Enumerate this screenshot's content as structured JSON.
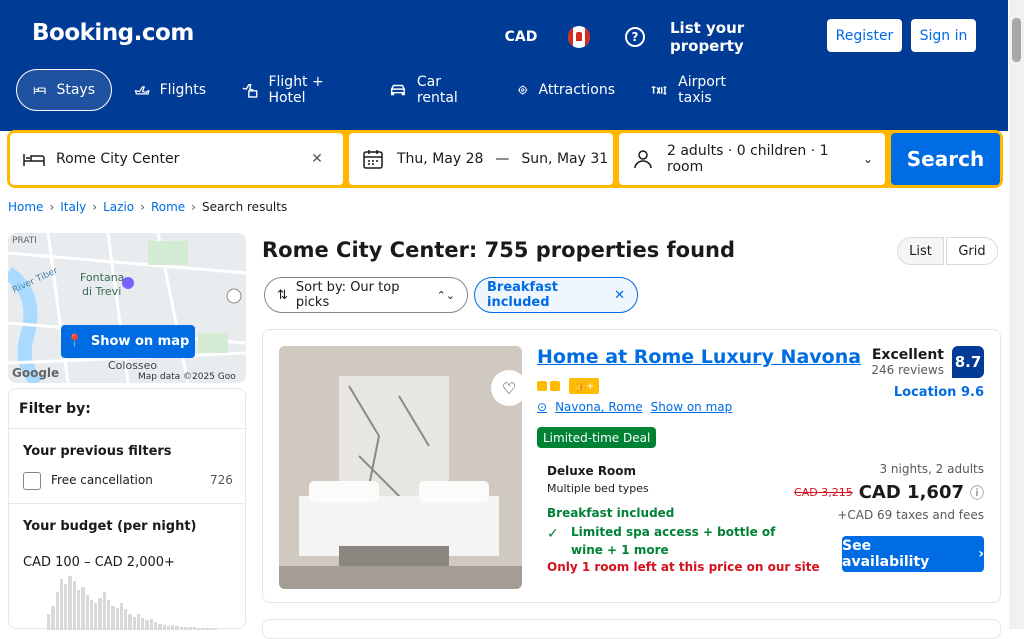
{
  "header": {
    "logo": "Booking.com",
    "currency": "CAD",
    "list_property": "List your property",
    "register": "Register",
    "sign_in": "Sign in",
    "tabs": [
      {
        "label": "Stays",
        "icon": "bed-icon"
      },
      {
        "label": "Flights",
        "icon": "plane-icon"
      },
      {
        "label": "Flight + Hotel",
        "icon": "flight-hotel-icon"
      },
      {
        "label": "Car rental",
        "icon": "car-icon"
      },
      {
        "label": "Attractions",
        "icon": "attractions-icon"
      },
      {
        "label": "Airport taxis",
        "icon": "taxi-icon"
      }
    ]
  },
  "search": {
    "destination": "Rome City Center",
    "checkin": "Thu, May 28",
    "date_sep": "—",
    "checkout": "Sun, May 31",
    "guests": "2 adults · 0 children · 1 room",
    "button": "Search"
  },
  "breadcrumb": [
    "Home",
    "Italy",
    "Lazio",
    "Rome",
    "Search results"
  ],
  "map": {
    "button": "Show on map",
    "labels": {
      "prati": "PRATI",
      "fontana1": "Fontana",
      "fontana2": "di Trevi",
      "river": "River Tiber",
      "colosseo": "Colosseo",
      "google": "Google",
      "credit": "Map data ©2025 Goo"
    }
  },
  "filters": {
    "title": "Filter by:",
    "previous": "Your previous filters",
    "free_cancel": "Free cancellation",
    "free_cancel_count": "726",
    "budget_title": "Your budget (per night)",
    "budget_range": "CAD 100 – CAD 2,000+",
    "histogram": [
      0.3,
      0.45,
      0.7,
      0.95,
      0.85,
      1.0,
      0.9,
      0.75,
      0.8,
      0.65,
      0.55,
      0.5,
      0.6,
      0.7,
      0.55,
      0.45,
      0.4,
      0.5,
      0.38,
      0.3,
      0.25,
      0.3,
      0.22,
      0.18,
      0.2,
      0.14,
      0.12,
      0.1,
      0.08,
      0.1,
      0.07,
      0.06,
      0.05,
      0.06,
      0.05,
      0.04,
      0.04,
      0.03,
      0.03,
      0.02
    ]
  },
  "results": {
    "title": "Rome City Center: 755 properties found",
    "view_list": "List",
    "view_grid": "Grid",
    "sort": "Sort by: Our top picks",
    "chip_breakfast": "Breakfast included"
  },
  "card": {
    "title": "Home at Rome Luxury Navona",
    "location": "Navona, Rome",
    "show_on_map": "Show on map",
    "deal": "Limited-time Deal",
    "room": "Deluxe Room",
    "beds": "Multiple bed types",
    "breakfast": "Breakfast included",
    "spa": "Limited spa access + bottle of wine + 1 more",
    "left": "Only 1 room left at this price on our site",
    "score_word": "Excellent",
    "reviews": "246 reviews",
    "score": "8.7",
    "location_score": "Location 9.6",
    "nights": "3 nights, 2 adults",
    "old_price": "CAD 3,215",
    "price": "CAD 1,607",
    "taxes": "+CAD 69 taxes and fees",
    "availability": "See availability"
  },
  "colors": {
    "brand": "#003b95",
    "accent": "#006ce4",
    "search_border": "#ffb700",
    "deal_green": "#008234",
    "warning_red": "#d4111e"
  }
}
